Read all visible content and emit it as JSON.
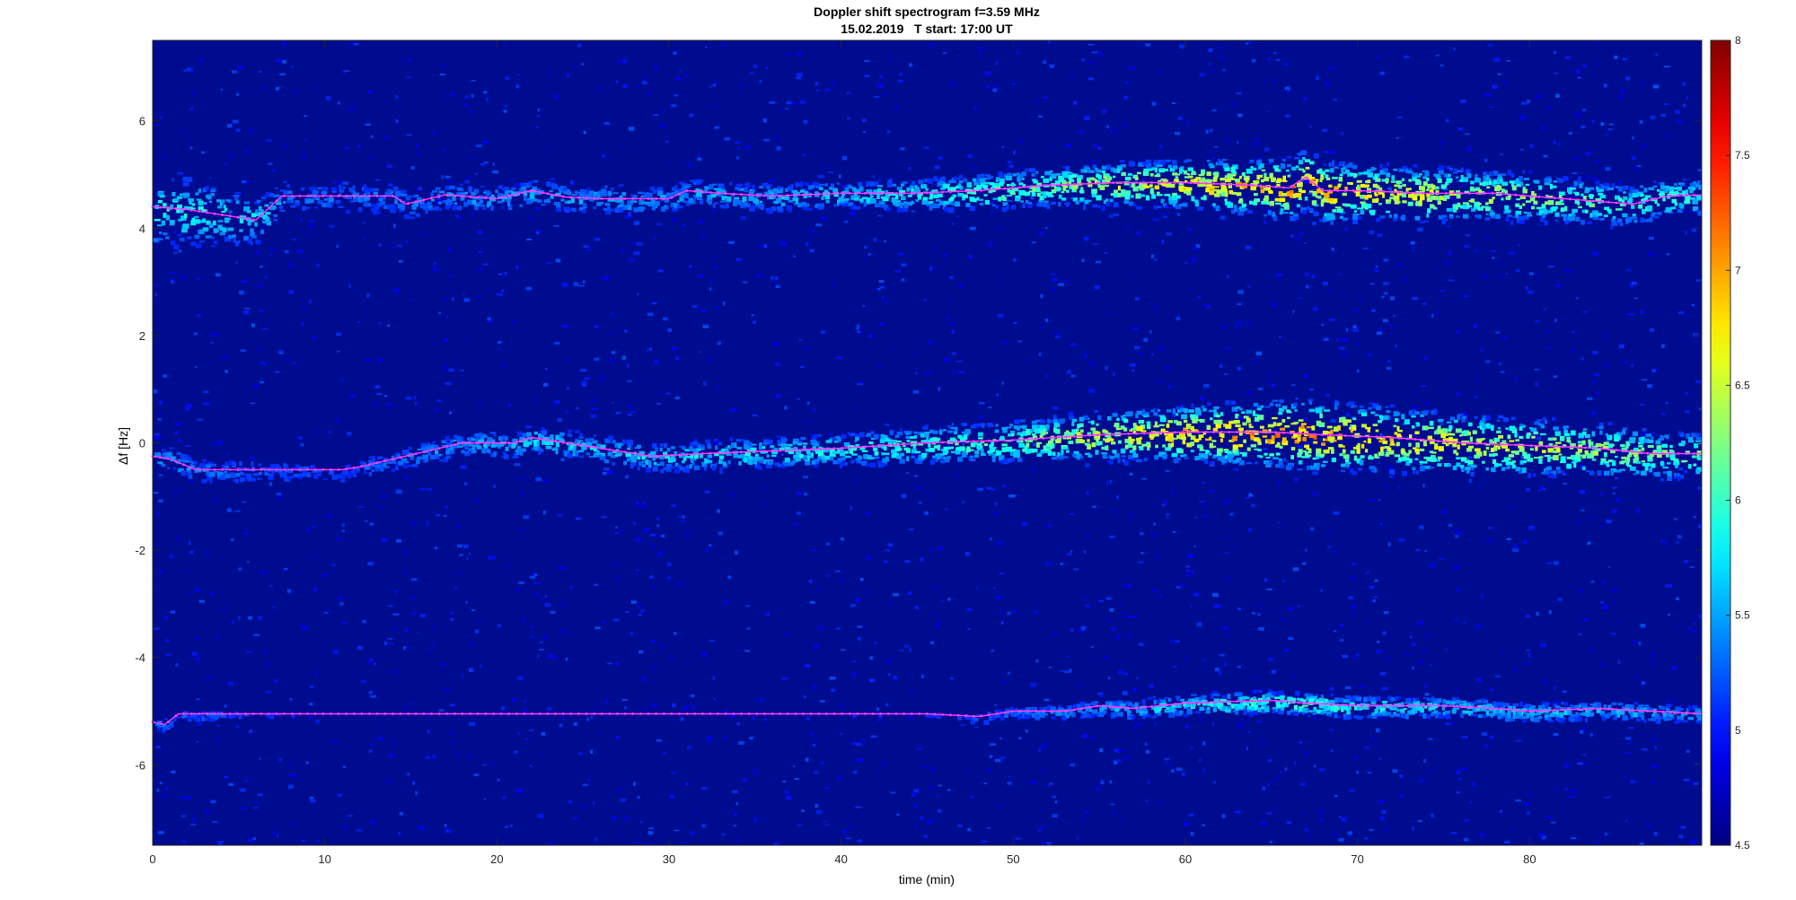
{
  "chart_data": {
    "type": "heatmap",
    "title": "Doppler shift spectrogram f=3.59 MHz",
    "subtitle": "15.02.2019   T start: 17:00 UT",
    "xlabel": "time (min)",
    "ylabel": "Δf [Hz]",
    "xlim": [
      0,
      90
    ],
    "ylim": [
      -7.5,
      7.5
    ],
    "xticks": [
      0,
      10,
      20,
      30,
      40,
      50,
      60,
      70,
      80
    ],
    "yticks": [
      -6,
      -4,
      -2,
      0,
      2,
      4,
      6
    ],
    "colorbar": {
      "colormap": "jet",
      "limits": [
        4.5,
        8
      ],
      "ticks": [
        4.5,
        5,
        5.5,
        6,
        6.5,
        7,
        7.5,
        8
      ],
      "placement": "right"
    },
    "grid": false,
    "background_color": "#000c8f",
    "trace_color": "#ff3cff",
    "bands": [
      {
        "name": "",
        "center": [
          [
            0,
            4.4
          ],
          [
            2,
            4.35
          ],
          [
            4,
            4.25
          ],
          [
            6,
            4.15
          ],
          [
            7.5,
            4.6
          ],
          [
            10,
            4.6
          ],
          [
            12,
            4.6
          ],
          [
            14,
            4.6
          ],
          [
            14.7,
            4.45
          ],
          [
            17,
            4.62
          ],
          [
            20,
            4.55
          ],
          [
            22,
            4.7
          ],
          [
            24,
            4.58
          ],
          [
            26,
            4.55
          ],
          [
            28,
            4.55
          ],
          [
            30,
            4.55
          ],
          [
            31,
            4.7
          ],
          [
            33,
            4.65
          ],
          [
            36,
            4.6
          ],
          [
            40,
            4.65
          ],
          [
            44,
            4.65
          ],
          [
            48,
            4.7
          ],
          [
            52,
            4.8
          ],
          [
            56,
            4.85
          ],
          [
            60,
            4.85
          ],
          [
            64,
            4.8
          ],
          [
            66,
            4.75
          ],
          [
            67,
            4.95
          ],
          [
            68,
            4.7
          ],
          [
            70,
            4.7
          ],
          [
            74,
            4.65
          ],
          [
            78,
            4.65
          ],
          [
            82,
            4.55
          ],
          [
            86,
            4.45
          ],
          [
            88,
            4.6
          ],
          [
            90,
            4.62
          ]
        ],
        "intensity": [
          [
            0,
            6.0
          ],
          [
            6,
            5.9
          ],
          [
            8,
            5.4
          ],
          [
            15,
            5.5
          ],
          [
            20,
            5.6
          ],
          [
            30,
            5.6
          ],
          [
            40,
            5.8
          ],
          [
            50,
            6.3
          ],
          [
            60,
            7.0
          ],
          [
            67,
            7.3
          ],
          [
            70,
            7.0
          ],
          [
            80,
            6.5
          ],
          [
            90,
            6.0
          ]
        ],
        "width": [
          [
            0,
            0.55
          ],
          [
            8,
            0.25
          ],
          [
            40,
            0.2
          ],
          [
            60,
            0.28
          ],
          [
            67,
            0.35
          ],
          [
            90,
            0.25
          ]
        ]
      },
      {
        "name": "",
        "center": [
          [
            0,
            -0.25
          ],
          [
            1,
            -0.3
          ],
          [
            2.5,
            -0.5
          ],
          [
            5,
            -0.5
          ],
          [
            8,
            -0.5
          ],
          [
            11,
            -0.5
          ],
          [
            12,
            -0.45
          ],
          [
            14,
            -0.3
          ],
          [
            16,
            -0.15
          ],
          [
            18,
            0.0
          ],
          [
            21,
            0.0
          ],
          [
            22,
            0.1
          ],
          [
            24,
            0.0
          ],
          [
            27,
            -0.15
          ],
          [
            29,
            -0.25
          ],
          [
            32,
            -0.2
          ],
          [
            36,
            -0.15
          ],
          [
            40,
            -0.1
          ],
          [
            45,
            0.0
          ],
          [
            50,
            0.05
          ],
          [
            55,
            0.15
          ],
          [
            60,
            0.2
          ],
          [
            65,
            0.2
          ],
          [
            68,
            0.15
          ],
          [
            72,
            0.1
          ],
          [
            76,
            0.0
          ],
          [
            80,
            -0.05
          ],
          [
            84,
            -0.1
          ],
          [
            87,
            -0.2
          ],
          [
            90,
            -0.2
          ]
        ],
        "intensity": [
          [
            0,
            5.6
          ],
          [
            10,
            5.2
          ],
          [
            16,
            5.5
          ],
          [
            22,
            5.8
          ],
          [
            30,
            5.8
          ],
          [
            40,
            6.0
          ],
          [
            50,
            6.3
          ],
          [
            60,
            7.2
          ],
          [
            67,
            7.3
          ],
          [
            72,
            7.0
          ],
          [
            80,
            6.7
          ],
          [
            90,
            6.3
          ]
        ],
        "width": [
          [
            0,
            0.2
          ],
          [
            20,
            0.2
          ],
          [
            40,
            0.22
          ],
          [
            60,
            0.32
          ],
          [
            67,
            0.4
          ],
          [
            90,
            0.3
          ]
        ]
      },
      {
        "name": "",
        "center": [
          [
            0,
            -5.2
          ],
          [
            0.7,
            -5.25
          ],
          [
            1.5,
            -5.05
          ],
          [
            10,
            -5.05
          ],
          [
            20,
            -5.05
          ],
          [
            30,
            -5.05
          ],
          [
            40,
            -5.05
          ],
          [
            45,
            -5.05
          ],
          [
            48,
            -5.1
          ],
          [
            50,
            -5.0
          ],
          [
            53,
            -5.0
          ],
          [
            55,
            -4.9
          ],
          [
            57,
            -4.95
          ],
          [
            60,
            -4.85
          ],
          [
            65,
            -4.8
          ],
          [
            67,
            -4.85
          ],
          [
            70,
            -4.9
          ],
          [
            75,
            -4.9
          ],
          [
            78,
            -4.95
          ],
          [
            80,
            -5.0
          ],
          [
            84,
            -4.95
          ],
          [
            87,
            -5.0
          ],
          [
            90,
            -5.05
          ]
        ],
        "intensity": [
          [
            0,
            5.4
          ],
          [
            10,
            5.0
          ],
          [
            30,
            5.0
          ],
          [
            45,
            5.1
          ],
          [
            55,
            5.6
          ],
          [
            67,
            6.2
          ],
          [
            75,
            5.8
          ],
          [
            90,
            5.6
          ]
        ],
        "width": [
          [
            0,
            0.1
          ],
          [
            45,
            0.12
          ],
          [
            60,
            0.15
          ],
          [
            90,
            0.14
          ]
        ]
      }
    ]
  }
}
